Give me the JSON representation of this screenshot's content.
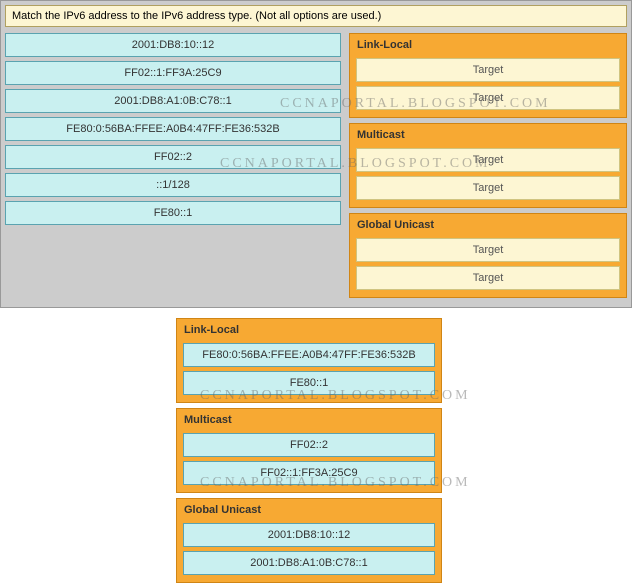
{
  "instruction": "Match the IPv6 address to the IPv6 address type. (Not all options are used.)",
  "sources": [
    "2001:DB8:10::12",
    "FF02::1:FF3A:25C9",
    "2001:DB8:A1:0B:C78::1",
    "FE80:0:56BA:FFEE:A0B4:47FF:FE36:532B",
    "FF02::2",
    "::1/128",
    "FE80::1"
  ],
  "top_categories": [
    {
      "title": "Link-Local",
      "slots": [
        "Target",
        "Target"
      ]
    },
    {
      "title": "Multicast",
      "slots": [
        "Target",
        "Target"
      ]
    },
    {
      "title": "Global Unicast",
      "slots": [
        "Target",
        "Target"
      ]
    }
  ],
  "bottom_categories": [
    {
      "title": "Link-Local",
      "answers": [
        "FE80:0:56BA:FFEE:A0B4:47FF:FE36:532B",
        "FE80::1"
      ]
    },
    {
      "title": "Multicast",
      "answers": [
        "FF02::2",
        "FF02::1:FF3A:25C9"
      ]
    },
    {
      "title": "Global Unicast",
      "answers": [
        "2001:DB8:10::12",
        "2001:DB8:A1:0B:C78::1"
      ]
    }
  ],
  "watermark": "CCNAPORTAL.BLOGSPOT.COM"
}
